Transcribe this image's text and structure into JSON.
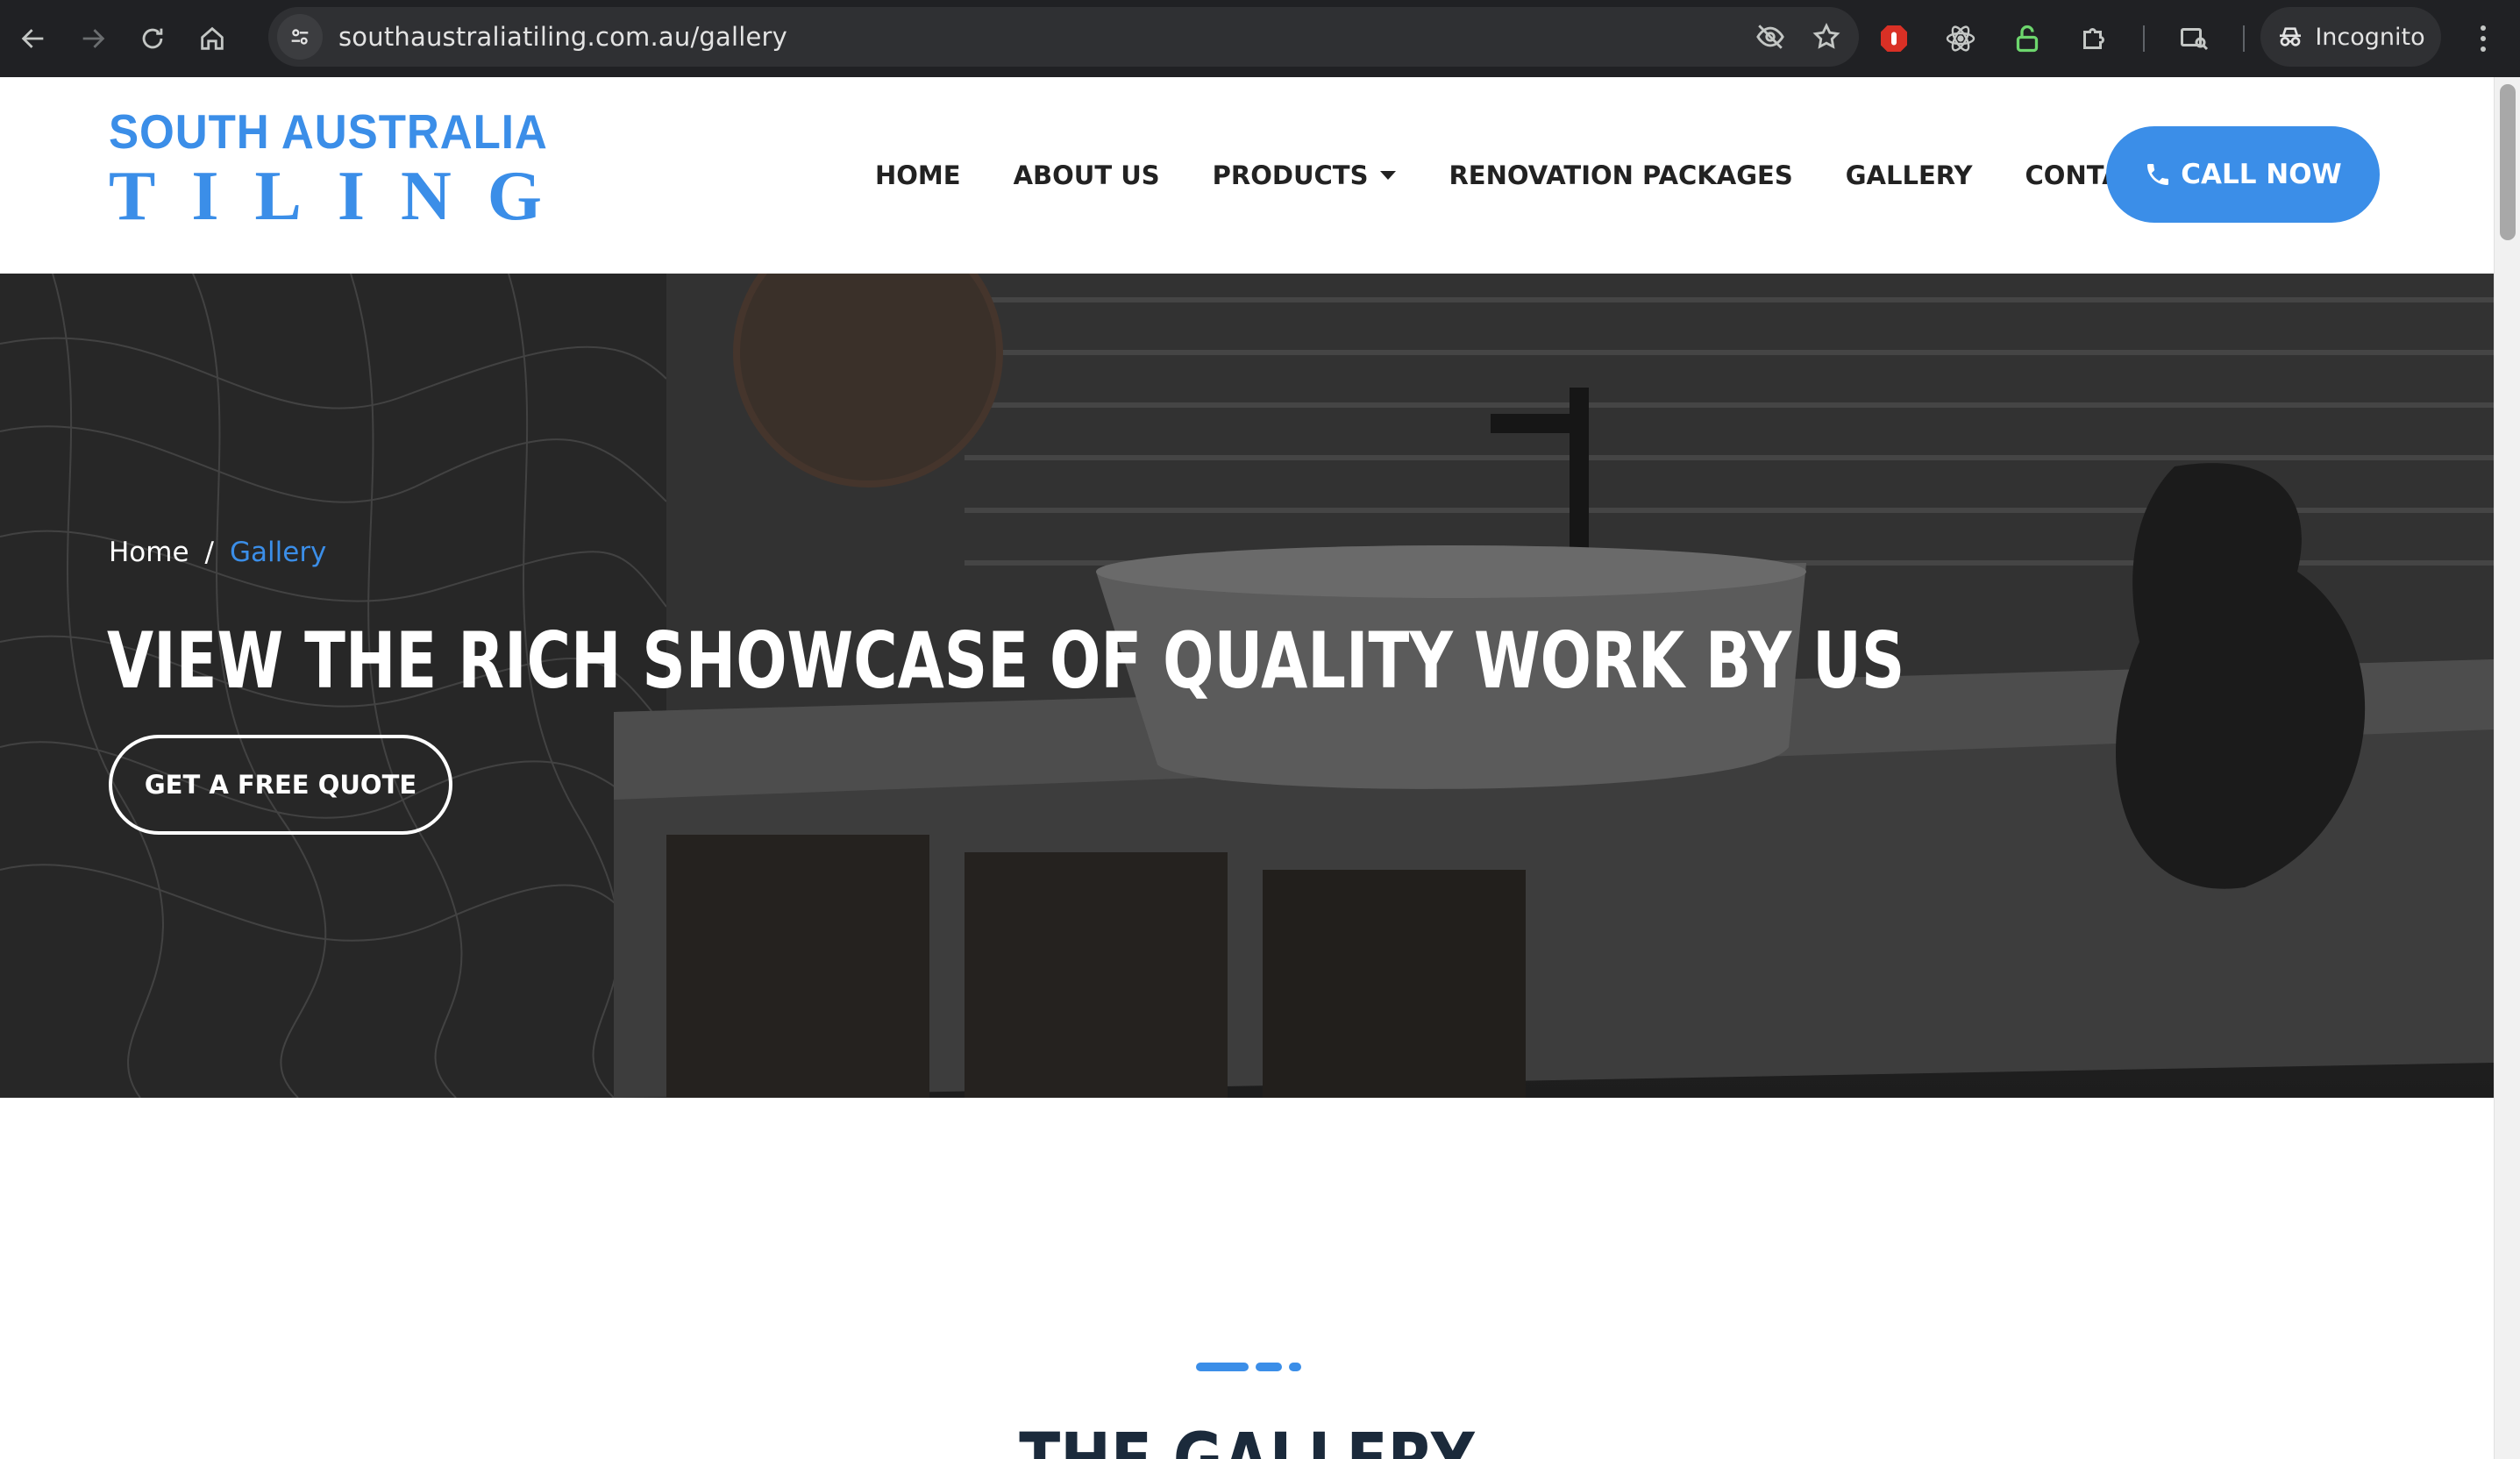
{
  "browser": {
    "url": "southaustraliatiling.com.au/gallery",
    "incognito_label": "Incognito",
    "icons": {
      "back": "arrow-left-icon",
      "forward": "arrow-right-icon",
      "reload": "reload-icon",
      "home": "home-icon",
      "site_info": "tune-icon",
      "eye_off": "eye-off-icon",
      "bookmark": "star-icon",
      "ext_adblock": "stop-hand-icon",
      "ext_react": "react-icon",
      "ext_lock": "padlock-icon",
      "ext_puzzle": "puzzle-icon",
      "ext_lens": "search-tab-icon"
    }
  },
  "site": {
    "logo": {
      "line1": "SOUTH AUSTRALIA",
      "line2": "TILING"
    },
    "nav": [
      {
        "label": "HOME"
      },
      {
        "label": "ABOUT US"
      },
      {
        "label": "PRODUCTS",
        "has_dropdown": true
      },
      {
        "label": "RENOVATION PACKAGES"
      },
      {
        "label": "GALLERY"
      },
      {
        "label": "CONTACT"
      }
    ],
    "call_label": "CALL NOW",
    "accent_color": "#3b8ee8"
  },
  "hero": {
    "breadcrumb": {
      "home": "Home",
      "separator": "/",
      "current": "Gallery"
    },
    "title": "VIEW THE RICH SHOWCASE OF QUALITY WORK BY US",
    "cta_label": "GET A FREE QUOTE"
  },
  "gallery": {
    "title": "THE GALLERY"
  }
}
